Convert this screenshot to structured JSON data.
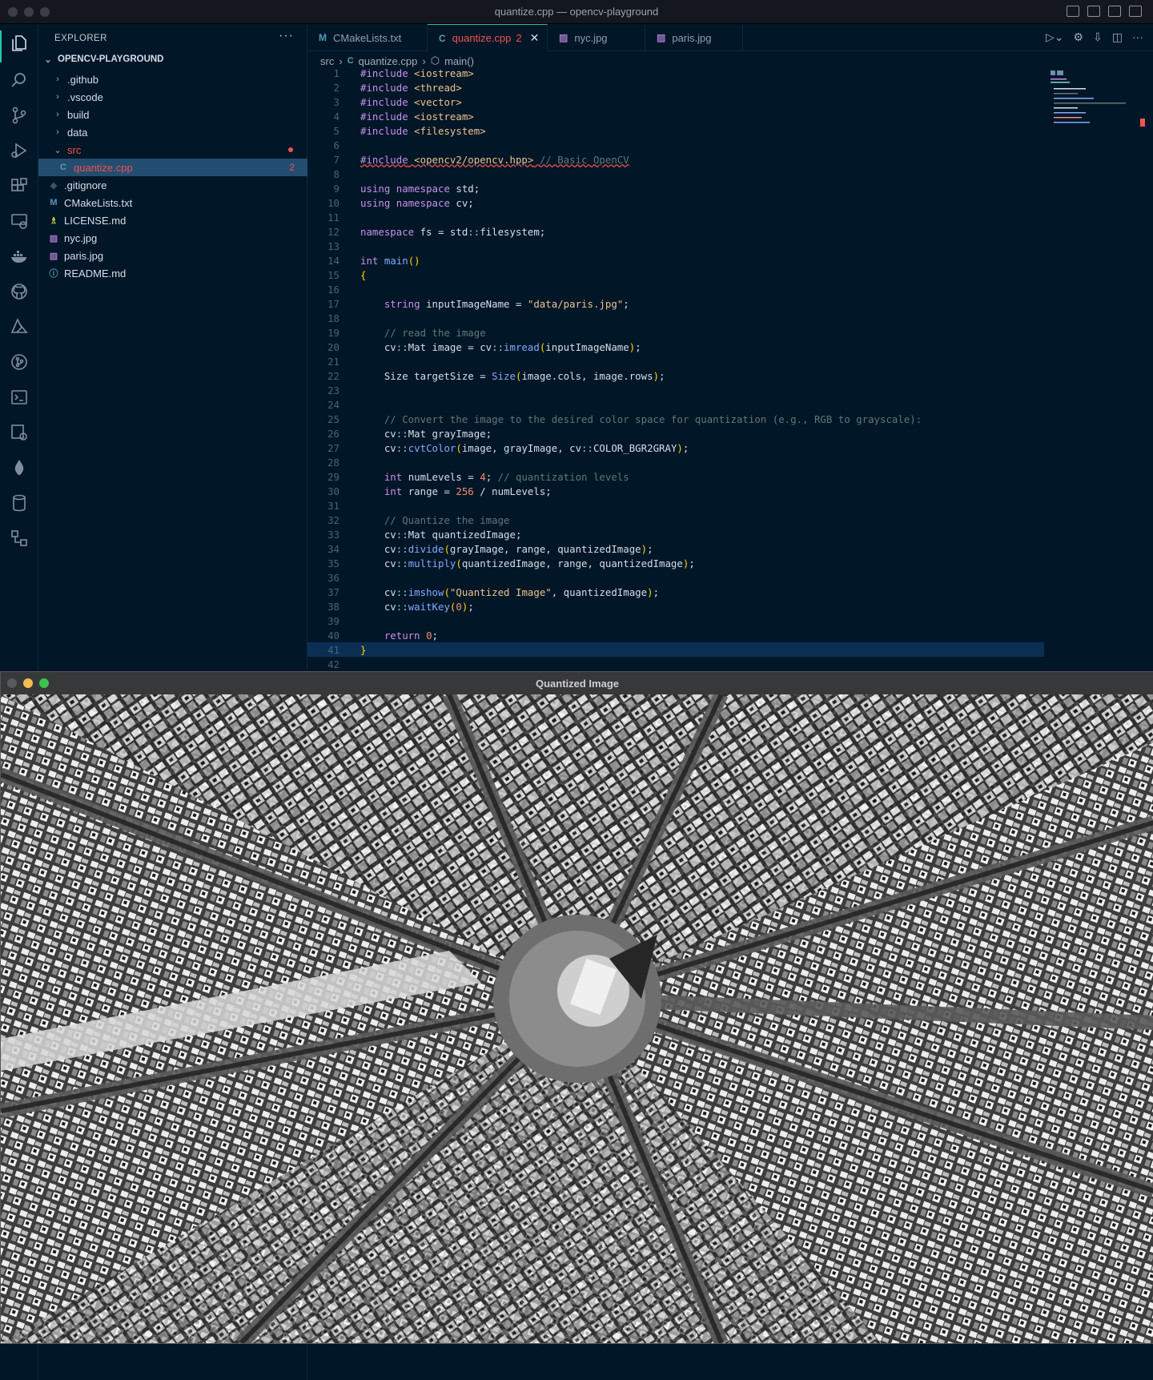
{
  "window": {
    "title": "quantize.cpp — opencv-playground"
  },
  "sidebar": {
    "title": "EXPLORER",
    "more": "···",
    "project": "OPENCV-PLAYGROUND",
    "items": [
      {
        "label": ".github",
        "kind": "folder"
      },
      {
        "label": ".vscode",
        "kind": "folder"
      },
      {
        "label": "build",
        "kind": "folder"
      },
      {
        "label": "data",
        "kind": "folder"
      },
      {
        "label": "src",
        "kind": "folder-open"
      },
      {
        "label": "quantize.cpp",
        "kind": "file",
        "icon": "C",
        "badge": "2"
      },
      {
        "label": ".gitignore",
        "kind": "file",
        "icon": "◆"
      },
      {
        "label": "CMakeLists.txt",
        "kind": "file",
        "icon": "M"
      },
      {
        "label": "LICENSE.md",
        "kind": "file",
        "icon": "♗"
      },
      {
        "label": "nyc.jpg",
        "kind": "file",
        "icon": "▨"
      },
      {
        "label": "paris.jpg",
        "kind": "file",
        "icon": "▨"
      },
      {
        "label": "README.md",
        "kind": "file",
        "icon": "ⓘ"
      }
    ]
  },
  "tabs": [
    {
      "label": "CMakeLists.txt",
      "icon": "M"
    },
    {
      "label": "quantize.cpp",
      "icon": "C",
      "badge": "2"
    },
    {
      "label": "nyc.jpg",
      "icon": "▨"
    },
    {
      "label": "paris.jpg",
      "icon": "▨"
    }
  ],
  "breadcrumb": {
    "folder": "src",
    "file": "quantize.cpp",
    "symbol": "main()"
  },
  "code": {
    "line_numbers": [
      "1",
      "2",
      "3",
      "4",
      "5",
      "6",
      "7",
      "8",
      "9",
      "10",
      "11",
      "12",
      "13",
      "14",
      "15",
      "16",
      "17",
      "18",
      "19",
      "20",
      "21",
      "22",
      "23",
      "24",
      "25",
      "26",
      "27",
      "28",
      "29",
      "30",
      "31",
      "32",
      "33",
      "34",
      "35",
      "36",
      "37",
      "38",
      "39",
      "40",
      "41",
      "42"
    ],
    "lines": [
      "#include <iostream>",
      "#include <thread>",
      "#include <vector>",
      "#include <iostream>",
      "#include <filesystem>",
      "",
      "#include <opencv2/opencv.hpp> // Basic OpenCV",
      "",
      "using namespace std;",
      "using namespace cv;",
      "",
      "namespace fs = std::filesystem;",
      "",
      "int main()",
      "{",
      "",
      "    string inputImageName = \"data/paris.jpg\";",
      "",
      "    // read the image",
      "    cv::Mat image = cv::imread(inputImageName);",
      "",
      "    Size targetSize = Size(image.cols, image.rows);",
      "",
      "",
      "    // Convert the image to the desired color space for quantization (e.g., RGB to grayscale):",
      "    cv::Mat grayImage;",
      "    cv::cvtColor(image, grayImage, cv::COLOR_BGR2GRAY);",
      "",
      "    int numLevels = 4; // quantization levels",
      "    int range = 256 / numLevels;",
      "",
      "    // Quantize the image",
      "    cv::Mat quantizedImage;",
      "    cv::divide(grayImage, range, quantizedImage);",
      "    cv::multiply(quantizedImage, range, quantizedImage);",
      "",
      "    cv::imshow(\"Quantized Image\", quantizedImage);",
      "    cv::waitKey(0);",
      "",
      "    return 0;",
      "}",
      ""
    ]
  },
  "image_window": {
    "title": "Quantized Image"
  },
  "colors": {
    "accent": "#21c7a8",
    "error": "#ef5350",
    "bg": "#011627"
  }
}
